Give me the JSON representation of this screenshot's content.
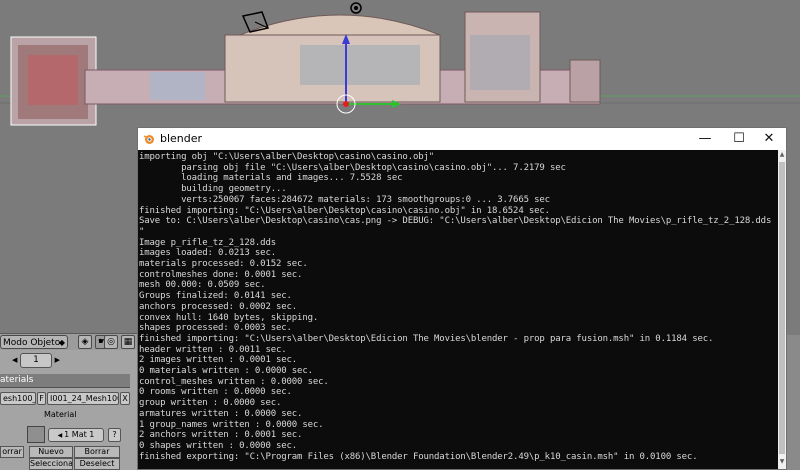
{
  "blender": {
    "mode_select": "Modo Objeto",
    "page_number": "1",
    "tab_label": "aterials",
    "mesh_field": "esh100_0",
    "f_toggle": "F",
    "material_field": "I001_24_Mesh100_0",
    "x_button": "X",
    "material_label": "Material",
    "mat_slot": "1 Mat 1",
    "question": "?",
    "btn_borrar_left": "orrar",
    "btn_nuevo": "Nuevo",
    "btn_borrar": "Borrar",
    "btn_seleccionar": "Seleccionar",
    "btn_deselect": "Deselect"
  },
  "console": {
    "title": "blender",
    "minimize": "—",
    "maximize": "☐",
    "close": "✕",
    "lines": [
      "importing obj \"C:\\Users\\alber\\Desktop\\casino\\casino.obj\"",
      "        parsing obj file \"C:\\Users\\alber\\Desktop\\casino\\casino.obj\"... 7.2179 sec",
      "        loading materials and images... 7.5528 sec",
      "        building geometry...",
      "        verts:250067 faces:284672 materials: 173 smoothgroups:0 ... 3.7665 sec",
      "finished importing: \"C:\\Users\\alber\\Desktop\\casino\\casino.obj\" in 18.6524 sec.",
      "Save to: C:\\Users\\alber\\Desktop\\casino\\cas.png -> DEBUG: \"C:\\Users\\alber\\Desktop\\Edicion The Movies\\p_rifle_tz_2_128.dds",
      "\"",
      "Image p_rifle_tz_2_128.dds",
      "images loaded: 0.0213 sec.",
      "materials processed: 0.0152 sec.",
      "controlmeshes done: 0.0001 sec.",
      "mesh 00.000: 0.0509 sec.",
      "Groups finalized: 0.0141 sec.",
      "anchors processed: 0.0002 sec.",
      "convex hull: 1640 bytes, skipping.",
      "shapes processed: 0.0003 sec.",
      "finished importing: \"C:\\Users\\alber\\Desktop\\Edicion The Movies\\blender - prop para fusion.msh\" in 0.1184 sec.",
      "header written : 0.0011 sec.",
      "2 images written : 0.0001 sec.",
      "0 materials written : 0.0000 sec.",
      "control_meshes written : 0.0000 sec.",
      "0 rooms written : 0.0000 sec.",
      "group written : 0.0000 sec.",
      "armatures written : 0.0000 sec.",
      "1 group_names written : 0.0000 sec.",
      "2 anchors written : 0.0001 sec.",
      "0 shapes written : 0.0000 sec.",
      "finished exporting: \"C:\\Program Files (x86)\\Blender Foundation\\Blender2.49\\p_k10_casin.msh\" in 0.0100 sec."
    ]
  }
}
